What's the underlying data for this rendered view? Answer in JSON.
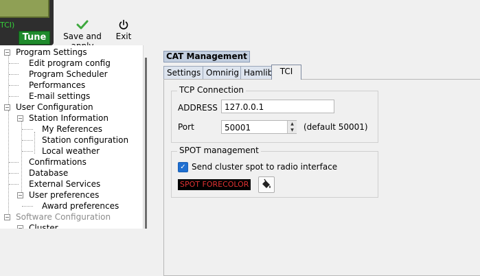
{
  "toolbar": {
    "rig_mode": "TCI)",
    "tune_label": "Tune",
    "save_label": "Save and apply",
    "exit_label": "Exit",
    "save_icon": "green-check-icon",
    "exit_icon": "power-icon"
  },
  "tree": {
    "items": [
      {
        "label": "Program Settings"
      },
      {
        "label": "Edit program config"
      },
      {
        "label": "Program Scheduler"
      },
      {
        "label": "Performances"
      },
      {
        "label": "E-mail settings"
      },
      {
        "label": "User Configuration"
      },
      {
        "label": "Station Information"
      },
      {
        "label": "My References"
      },
      {
        "label": "Station configuration"
      },
      {
        "label": "Local weather"
      },
      {
        "label": "Confirmations"
      },
      {
        "label": "Database"
      },
      {
        "label": "External Services"
      },
      {
        "label": "User preferences"
      },
      {
        "label": "Award preferences"
      },
      {
        "label": "Software Configuration"
      },
      {
        "label": "Cluster"
      }
    ]
  },
  "main": {
    "group_title": "CAT Management",
    "tabs": [
      {
        "label": "Settings"
      },
      {
        "label": "Omnirig"
      },
      {
        "label": "Hamlib"
      },
      {
        "label": "TCI"
      }
    ],
    "active_tab": "TCI",
    "tcp": {
      "legend": "TCP Connection",
      "address_label": "ADDRESS",
      "address_value": "127.0.0.1",
      "port_label": "Port",
      "port_value": "50001",
      "port_hint": "(default 50001)"
    },
    "spot": {
      "legend": "SPOT management",
      "send_spot_label": "Send cluster spot to radio interface",
      "send_spot_checked": true,
      "forecolor_label": "SPOT FORECOLOR",
      "forecolor_text_color": "#e03232",
      "forecolor_bg_color": "#000000"
    }
  },
  "colors": {
    "tune_green": "#1f8a2c",
    "title_blue": "#c3cfe0",
    "checkbox_blue": "#1f6fd1"
  }
}
